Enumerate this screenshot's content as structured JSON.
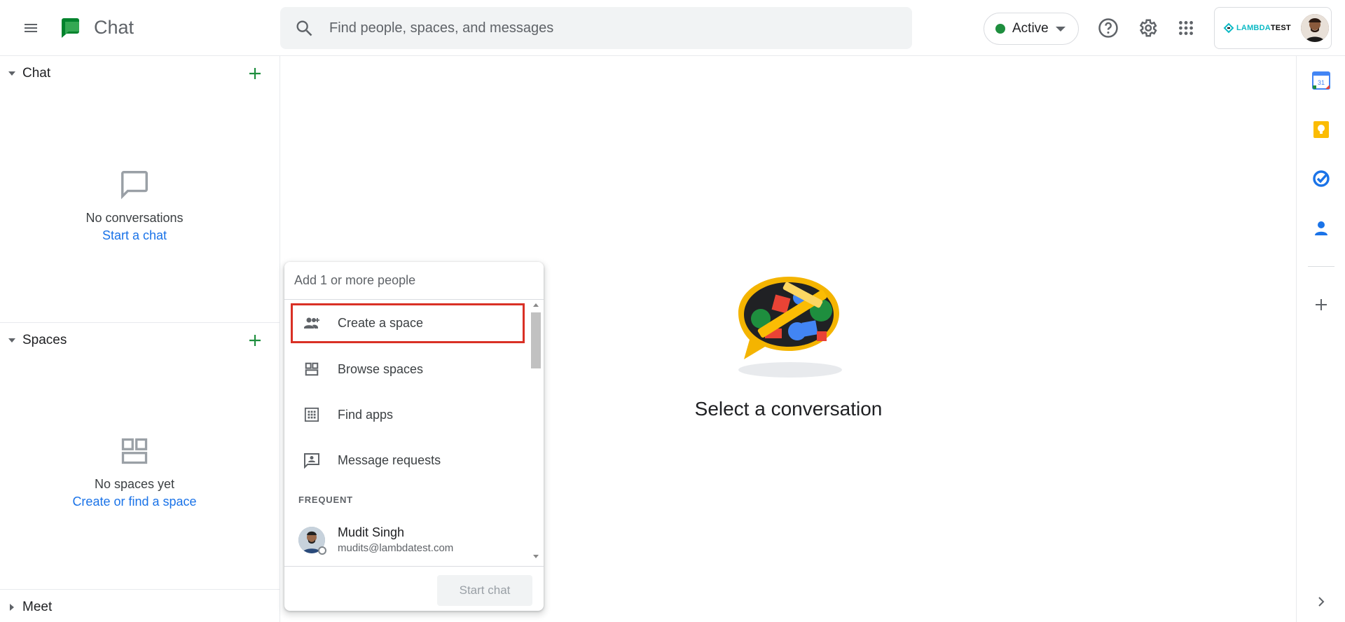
{
  "header": {
    "app_name": "Chat",
    "search_placeholder": "Find people, spaces, and messages",
    "status_label": "Active",
    "brand_text_a": "LAMBDA",
    "brand_text_b": "TEST"
  },
  "sidebar": {
    "chat": {
      "title": "Chat",
      "empty_text": "No conversations",
      "empty_link": "Start a chat"
    },
    "spaces": {
      "title": "Spaces",
      "empty_text": "No spaces yet",
      "empty_link": "Create or find a space"
    },
    "meet": {
      "title": "Meet"
    }
  },
  "main": {
    "select_text": "Select a conversation"
  },
  "popup": {
    "input_placeholder": "Add 1 or more people",
    "items": [
      {
        "label": "Create a space",
        "icon": "group-add-icon"
      },
      {
        "label": "Browse spaces",
        "icon": "browse-spaces-icon"
      },
      {
        "label": "Find apps",
        "icon": "apps-grid-icon"
      },
      {
        "label": "Message requests",
        "icon": "message-request-icon"
      }
    ],
    "frequent_label": "FREQUENT",
    "contacts": [
      {
        "name": "Mudit Singh",
        "email": "mudits@lambdatest.com"
      }
    ],
    "start_button": "Start chat"
  },
  "rail": {
    "calendar_day": "31"
  },
  "colors": {
    "accent_green": "#1e8e3e",
    "link_blue": "#1a73e8",
    "highlight_red": "#d93025"
  }
}
